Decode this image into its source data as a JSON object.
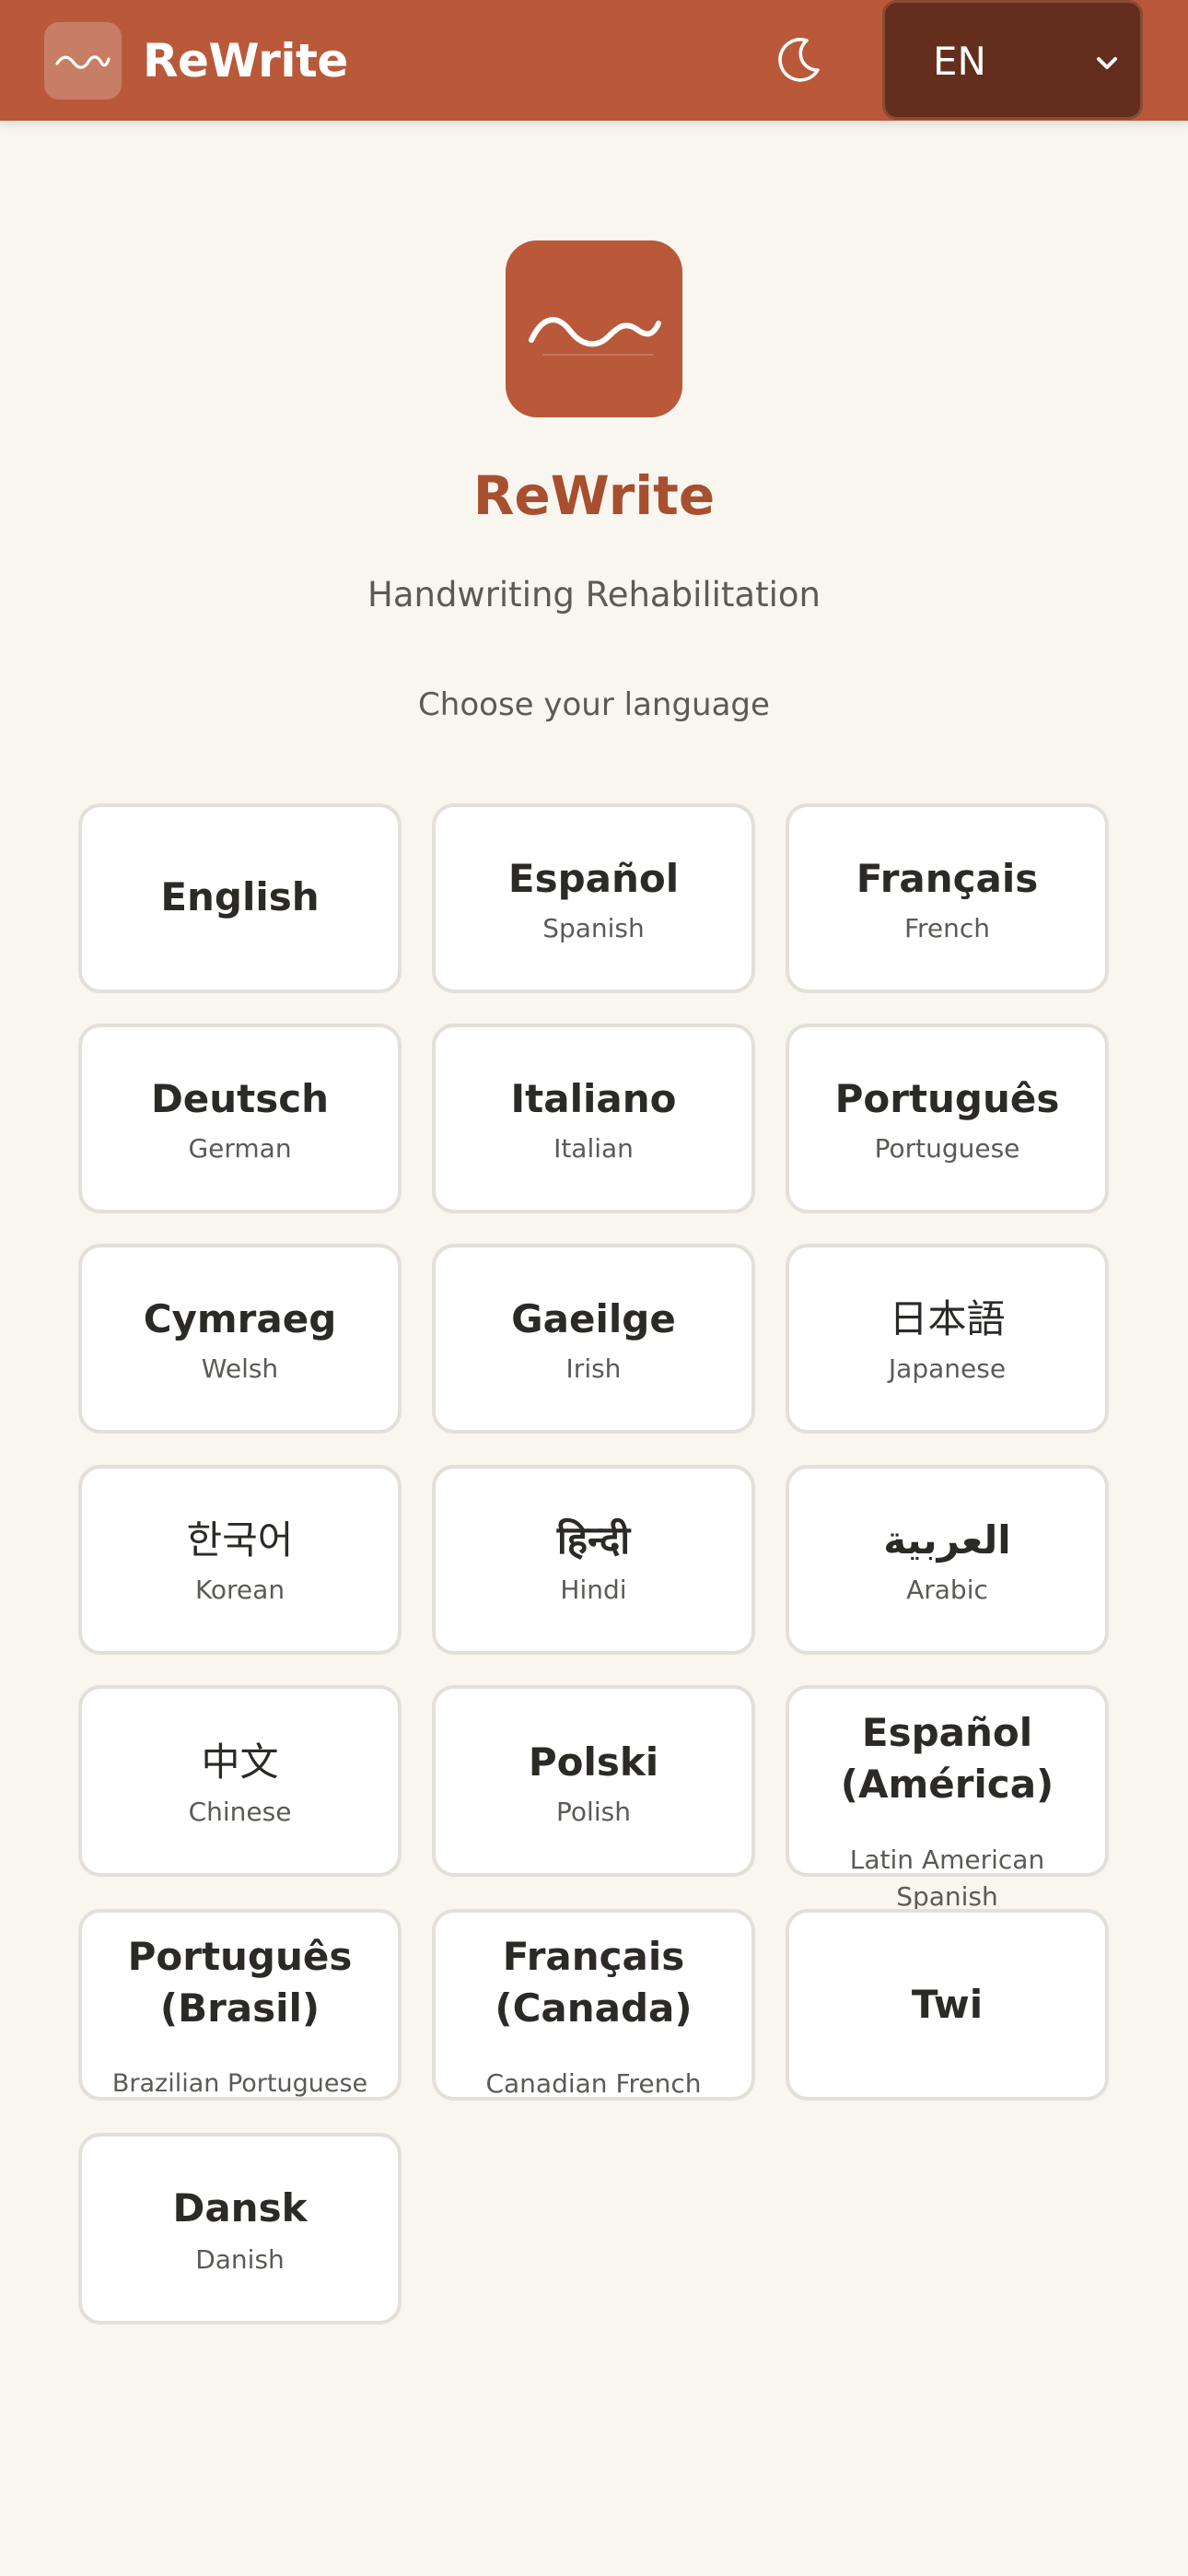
{
  "header": {
    "app_name": "ReWrite",
    "app_icon": "signature-wave-icon",
    "theme_icon": "moon-icon",
    "language_select": {
      "value": "EN",
      "icon": "chevron-down-icon"
    },
    "colors": {
      "bar": "#b9593a",
      "select_bg": "#632e1d"
    }
  },
  "hero": {
    "title": "ReWrite",
    "subtitle": "Handwriting Rehabilitation",
    "prompt": "Choose your language",
    "logo_icon": "signature-wave-icon",
    "accent": "#a84f30"
  },
  "languages": [
    {
      "name": "English",
      "sub": ""
    },
    {
      "name": "Español",
      "sub": "Spanish"
    },
    {
      "name": "Français",
      "sub": "French"
    },
    {
      "name": "Deutsch",
      "sub": "German"
    },
    {
      "name": "Italiano",
      "sub": "Italian"
    },
    {
      "name": "Português",
      "sub": "Portuguese"
    },
    {
      "name": "Cymraeg",
      "sub": "Welsh"
    },
    {
      "name": "Gaeilge",
      "sub": "Irish"
    },
    {
      "name": "日本語",
      "sub": "Japanese"
    },
    {
      "name": "한국어",
      "sub": "Korean"
    },
    {
      "name": "हिन्दी",
      "sub": "Hindi"
    },
    {
      "name": "العربية",
      "sub": "Arabic"
    },
    {
      "name": "中文",
      "sub": "Chinese"
    },
    {
      "name": "Polski",
      "sub": "Polish"
    },
    {
      "name": "Español (América)",
      "sub": "Latin American Spanish"
    },
    {
      "name": "Português (Brasil)",
      "sub": "Brazilian Portuguese"
    },
    {
      "name": "Français (Canada)",
      "sub": "Canadian French"
    },
    {
      "name": "Twi",
      "sub": ""
    },
    {
      "name": "Dansk",
      "sub": "Danish"
    }
  ]
}
